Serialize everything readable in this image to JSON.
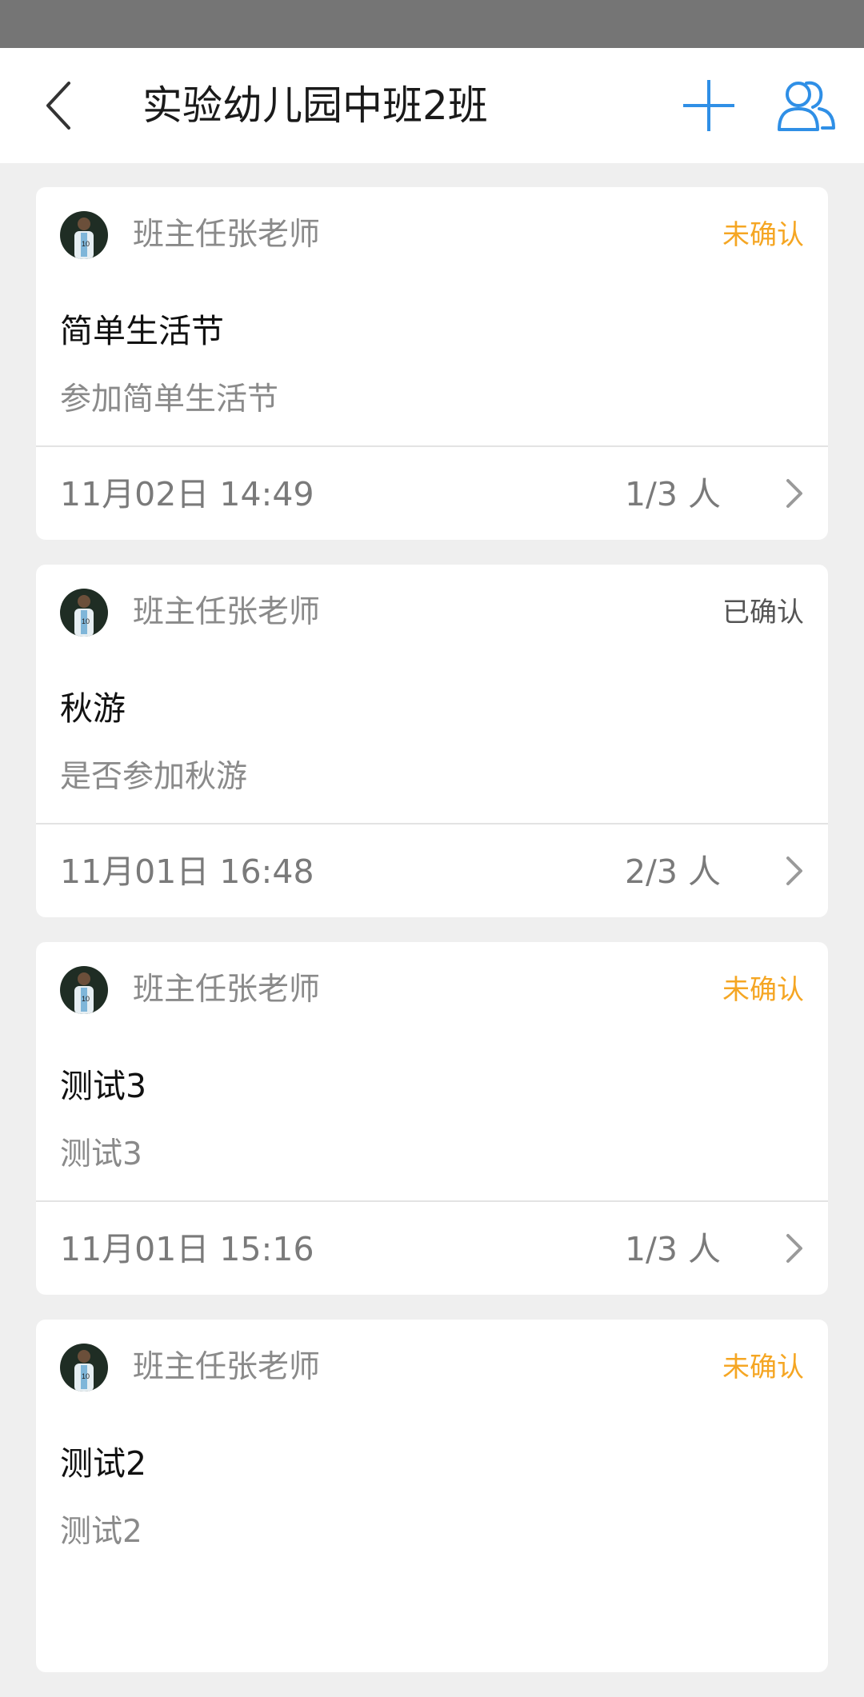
{
  "header": {
    "title": "实验幼儿园中班2班"
  },
  "notices": [
    {
      "author": "班主任张老师",
      "status": "未确认",
      "status_type": "pending",
      "title": "简单生活节",
      "desc": "参加简单生活节",
      "time": "11月02日 14:49",
      "count": "1/3 人"
    },
    {
      "author": "班主任张老师",
      "status": "已确认",
      "status_type": "done",
      "title": "秋游",
      "desc": "是否参加秋游",
      "time": "11月01日 16:48",
      "count": "2/3 人"
    },
    {
      "author": "班主任张老师",
      "status": "未确认",
      "status_type": "pending",
      "title": "测试3",
      "desc": "测试3",
      "time": "11月01日 15:16",
      "count": "1/3 人"
    },
    {
      "author": "班主任张老师",
      "status": "未确认",
      "status_type": "pending",
      "title": "测试2",
      "desc": "测试2",
      "time": "",
      "count": ""
    }
  ],
  "colors": {
    "accent": "#2f8fe6",
    "pending": "#f5a623",
    "background": "#efefef"
  },
  "icons": {
    "back": "chevron-left-icon",
    "add": "plus-icon",
    "members": "group-icon",
    "row": "chevron-right-icon"
  }
}
